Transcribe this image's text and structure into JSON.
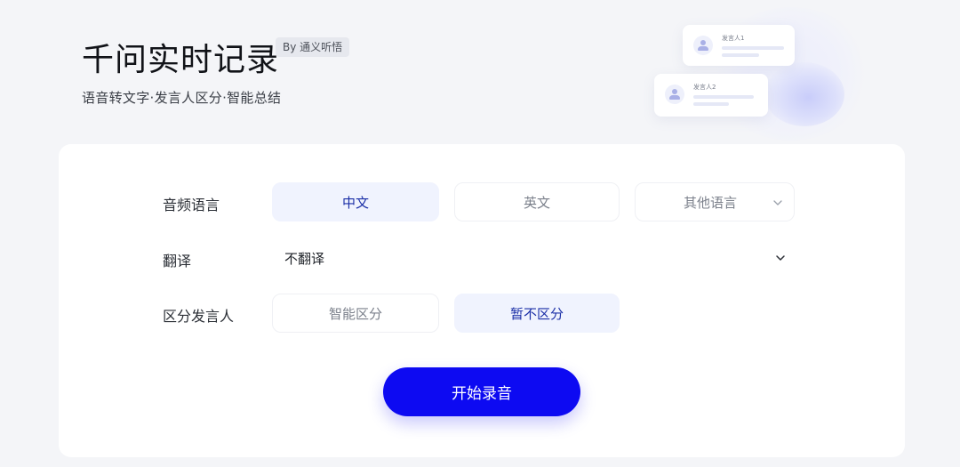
{
  "header": {
    "title": "千问实时记录",
    "by_badge": "By 通义听悟",
    "subtitle": "语音转文字·发言人区分·智能总结"
  },
  "illustration": {
    "speaker1": "发言人1",
    "speaker2": "发言人2"
  },
  "form": {
    "audio_language": {
      "label": "音频语言",
      "options": [
        "中文",
        "英文",
        "其他语言"
      ],
      "selected": "中文"
    },
    "translation": {
      "label": "翻译",
      "value": "不翻译"
    },
    "speaker_separation": {
      "label": "区分发言人",
      "options": [
        "智能区分",
        "暂不区分"
      ],
      "selected": "暂不区分"
    },
    "start_button": "开始录音"
  },
  "colors": {
    "accent": "#0d0af2",
    "selected_bg": "#f0f3fe",
    "selected_text": "#1b2fa7",
    "page_bg": "#f4f5f8"
  },
  "icons": [
    "chevron-down-icon",
    "user-avatar-icon"
  ]
}
